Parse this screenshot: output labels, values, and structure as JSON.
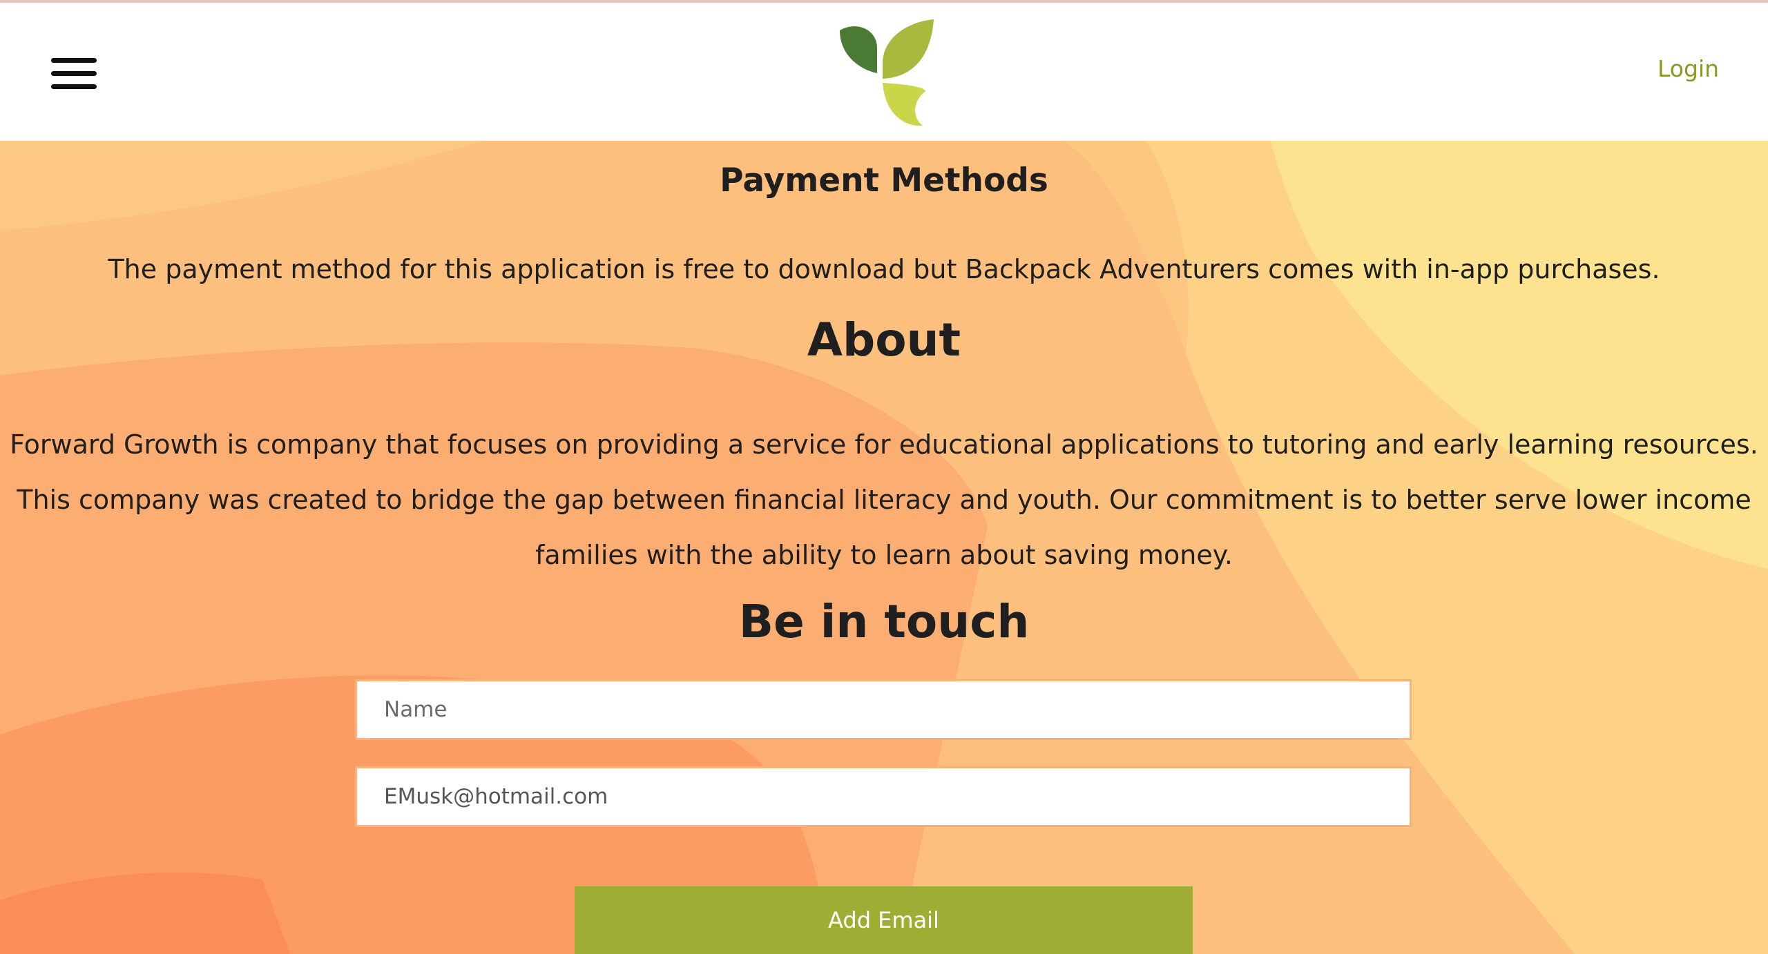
{
  "header": {
    "menu_icon": "hamburger-menu-icon",
    "logo_icon": "leaf-sprout-logo-icon",
    "login_label": "Login"
  },
  "payment": {
    "heading": "Payment Methods",
    "text": "The payment method for this application is free to download but Backpack Adventurers comes with in-app purchases."
  },
  "about": {
    "heading": "About",
    "text": "Forward Growth is company that focuses on providing a service for educational applications to tutoring and early learning resources. This company was created to bridge the gap between financial literacy and youth. Our commitment is to better serve lower income families with the ability to learn about saving money."
  },
  "contact": {
    "heading": "Be in touch",
    "name_placeholder": "Name",
    "email_value": "EMusk@hotmail.com",
    "submit_label": "Add Email"
  },
  "colors": {
    "accent": "#9eae35",
    "login": "#8a9a1e",
    "input_border": "#f7b27a",
    "bg_orange": "#fdb578",
    "bg_yellow": "#fde28c"
  }
}
